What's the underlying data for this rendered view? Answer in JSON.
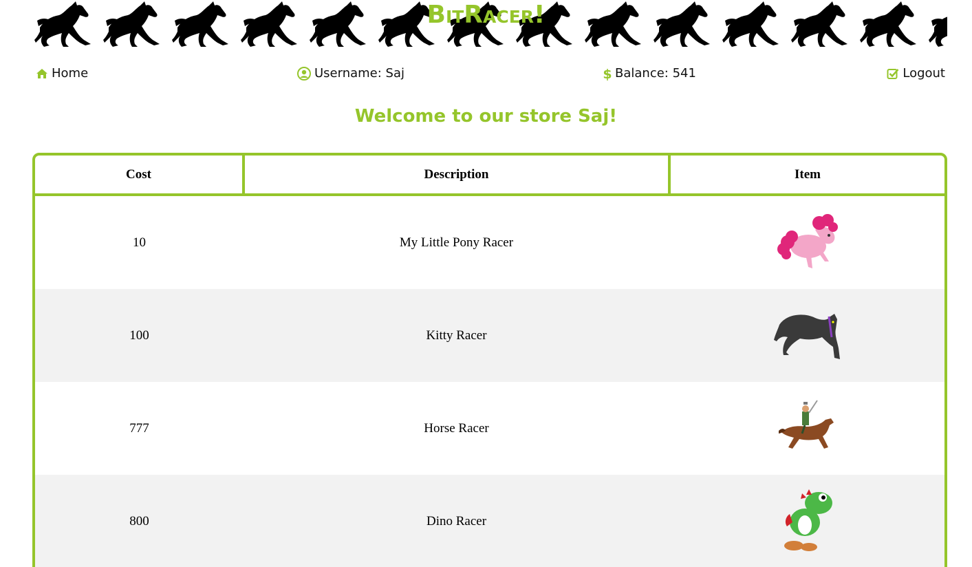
{
  "brand": {
    "title": "BitRacer!",
    "color": "#95c52b"
  },
  "nav": {
    "home": {
      "label": "Home",
      "icon": "home-icon"
    },
    "username": {
      "label": "Username: Saj",
      "icon": "user-circle-icon"
    },
    "balance": {
      "label": "Balance: 541",
      "icon": "dollar-icon"
    },
    "logout": {
      "label": "Logout",
      "icon": "check-square-icon"
    }
  },
  "welcome": "Welcome to our store Saj!",
  "table": {
    "headers": [
      "Cost",
      "Description",
      "Item"
    ],
    "rows": [
      {
        "cost": "10",
        "description": "My Little Pony Racer",
        "item_icon": "pink-pony-icon"
      },
      {
        "cost": "100",
        "description": "Kitty Racer",
        "item_icon": "black-panther-icon"
      },
      {
        "cost": "777",
        "description": "Horse Racer",
        "item_icon": "horse-rider-icon"
      },
      {
        "cost": "800",
        "description": "Dino Racer",
        "item_icon": "green-dino-icon"
      }
    ]
  },
  "colors": {
    "accent": "#95c52b",
    "row_alt": "#f2f2f2",
    "text": "#000000"
  }
}
